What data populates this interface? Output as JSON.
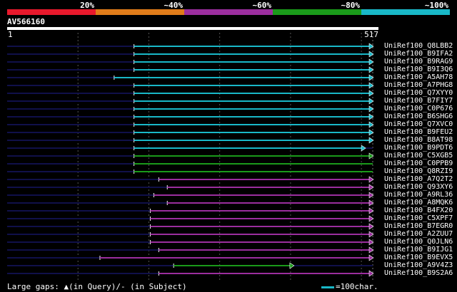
{
  "legend": {
    "labels": [
      "20%",
      "~40%",
      "~60%",
      "~80%",
      "~100%"
    ],
    "colors": [
      "#e8192c",
      "#e07c1a",
      "#9b2e9e",
      "#1a9a1a",
      "#19b8c8"
    ]
  },
  "query": {
    "id": "AV566160",
    "start": "1",
    "end": "517",
    "length": 517
  },
  "hits": [
    {
      "label": "UniRef100_Q8LBB2",
      "start": 180,
      "end": 517,
      "color": "cyan",
      "arrow": true
    },
    {
      "label": "UniRef100_B9IFA2",
      "start": 180,
      "end": 517,
      "color": "cyan",
      "arrow": true
    },
    {
      "label": "UniRef100_B9RAG9",
      "start": 180,
      "end": 517,
      "color": "cyan",
      "arrow": true
    },
    {
      "label": "UniRef100_B9I3Q6",
      "start": 180,
      "end": 517,
      "color": "cyan",
      "arrow": true
    },
    {
      "label": "UniRef100_A5AH78",
      "start": 152,
      "end": 517,
      "color": "cyan",
      "arrow": true
    },
    {
      "label": "UniRef100_A7PHG8",
      "start": 180,
      "end": 517,
      "color": "cyan",
      "arrow": true
    },
    {
      "label": "UniRef100_Q7XYY0",
      "start": 180,
      "end": 517,
      "color": "cyan",
      "arrow": true
    },
    {
      "label": "UniRef100_B7FIY7",
      "start": 180,
      "end": 517,
      "color": "cyan",
      "arrow": true
    },
    {
      "label": "UniRef100_C0P676",
      "start": 180,
      "end": 517,
      "color": "cyan",
      "arrow": true
    },
    {
      "label": "UniRef100_B6SHG6",
      "start": 180,
      "end": 517,
      "color": "cyan",
      "arrow": true
    },
    {
      "label": "UniRef100_Q7XVC0",
      "start": 180,
      "end": 517,
      "color": "cyan",
      "arrow": true
    },
    {
      "label": "UniRef100_B9FEU2",
      "start": 180,
      "end": 517,
      "color": "cyan",
      "arrow": true
    },
    {
      "label": "UniRef100_B8AT98",
      "start": 180,
      "end": 517,
      "color": "cyan",
      "arrow": true
    },
    {
      "label": "UniRef100_B9PDT6",
      "start": 180,
      "end": 506,
      "color": "cyan",
      "arrow": true
    },
    {
      "label": "UniRef100_C5XGB5",
      "start": 180,
      "end": 517,
      "color": "green",
      "arrow": true
    },
    {
      "label": "UniRef100_C0PPB9",
      "start": 180,
      "end": 517,
      "color": "green",
      "arrow": false
    },
    {
      "label": "UniRef100_Q8RZI9",
      "start": 180,
      "end": 517,
      "color": "green",
      "arrow": false
    },
    {
      "label": "UniRef100_A7Q2T2",
      "start": 215,
      "end": 517,
      "color": "purple",
      "arrow": true
    },
    {
      "label": "UniRef100_Q93XY6",
      "start": 227,
      "end": 517,
      "color": "purple",
      "arrow": true
    },
    {
      "label": "UniRef100_A9RL36",
      "start": 208,
      "end": 517,
      "color": "purple",
      "arrow": true
    },
    {
      "label": "UniRef100_A8MQK6",
      "start": 227,
      "end": 517,
      "color": "purple",
      "arrow": true
    },
    {
      "label": "UniRef100_B4FX20",
      "start": 203,
      "end": 517,
      "color": "purple",
      "arrow": true
    },
    {
      "label": "UniRef100_C5XPF7",
      "start": 203,
      "end": 517,
      "color": "purple",
      "arrow": true
    },
    {
      "label": "UniRef100_B7EGR0",
      "start": 203,
      "end": 517,
      "color": "purple",
      "arrow": true
    },
    {
      "label": "UniRef100_A2ZUU7",
      "start": 203,
      "end": 517,
      "color": "purple",
      "arrow": true
    },
    {
      "label": "UniRef100_Q0JLN6",
      "start": 203,
      "end": 517,
      "color": "purple",
      "arrow": true
    },
    {
      "label": "UniRef100_B9IJG1",
      "start": 215,
      "end": 517,
      "color": "purple",
      "arrow": true
    },
    {
      "label": "UniRef100_B9EVX5",
      "start": 132,
      "end": 517,
      "color": "purple",
      "arrow": true
    },
    {
      "label": "UniRef100_A9V4Z3",
      "start": 236,
      "end": 405,
      "color": "green",
      "arrow": true
    },
    {
      "label": "UniRef100_B9S2A6",
      "start": 215,
      "end": 517,
      "color": "purple",
      "arrow": true
    }
  ],
  "footer": {
    "gaps_text": "Large gaps: ▲(in Query)/- (in Subject)",
    "scale_text": "=100char."
  }
}
